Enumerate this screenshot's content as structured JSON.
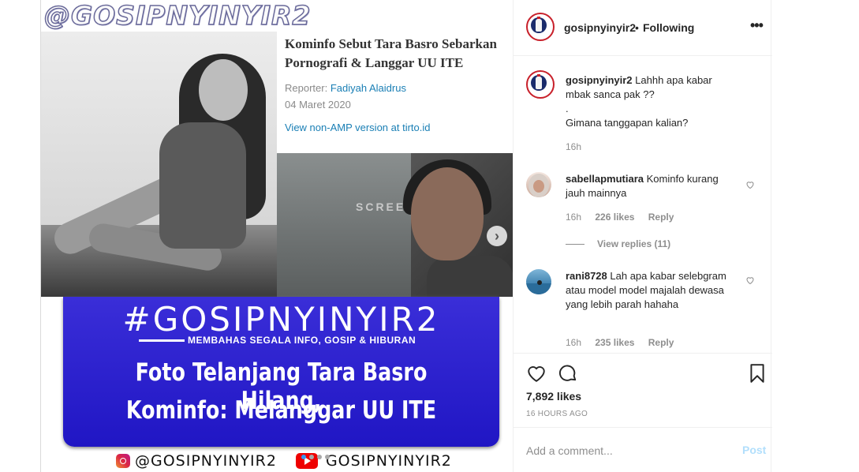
{
  "media": {
    "watermark": "@GOSIPNYINYIR2",
    "article": {
      "title": "Kominfo Sebut Tara Basro Sebarkan Pornografi & Langgar UU ITE",
      "reporter_label": "Reporter:",
      "reporter_name": "Fadiyah Alaidrus",
      "date": "04 Maret 2020",
      "link": "View non-AMP version at tirto.id"
    },
    "screen_text": "SCREE",
    "banner": {
      "hashtag": "#GOSIPNYINYIR2",
      "subtitle": "MEMBAHAS SEGALA INFO, GOSIP & HIBURAN",
      "headline_1": "Foto Telanjang Tara Basro Hilang,",
      "headline_2": "Kominfo: Melanggar UU ITE",
      "social_ig": "@GOSIPNYINYIR2",
      "social_yt": "GOSIPNYINYIR2"
    },
    "carousel": {
      "total": 4,
      "current": 1
    }
  },
  "header": {
    "username": "gosipnyinyir2",
    "separator": "•",
    "follow_status": "Following",
    "more_icon": "more-horizontal-icon"
  },
  "caption": {
    "username": "gosipnyinyir2",
    "line1": "Lahhh apa kabar mbak sanca pak ??",
    "line2": ".",
    "line3": "Gimana tanggapan kalian?",
    "time": "16h"
  },
  "comments": [
    {
      "username": "sabellapmutiara",
      "text": "Kominfo kurang jauh mainnya",
      "time": "16h",
      "likes": "226 likes",
      "reply": "Reply",
      "view_replies": "View replies (11)"
    },
    {
      "username": "rani8728",
      "text": "Lah apa kabar selebgram atau model model majalah dewasa yang lebih parah hahaha",
      "time": "16h",
      "likes": "235 likes",
      "reply": "Reply"
    }
  ],
  "actions": {
    "like_icon": "heart-icon",
    "comment_icon": "comment-icon",
    "save_icon": "bookmark-icon",
    "likes_count": "7,892 likes",
    "time_ago": "16 HOURS AGO"
  },
  "add_comment": {
    "placeholder": "Add a comment...",
    "post_label": "Post"
  },
  "colors": {
    "banner_blue": "#2016c4",
    "link_blue": "#1a7fb5",
    "post_disabled": "#b2dffc",
    "muted": "#8e8e8e"
  }
}
